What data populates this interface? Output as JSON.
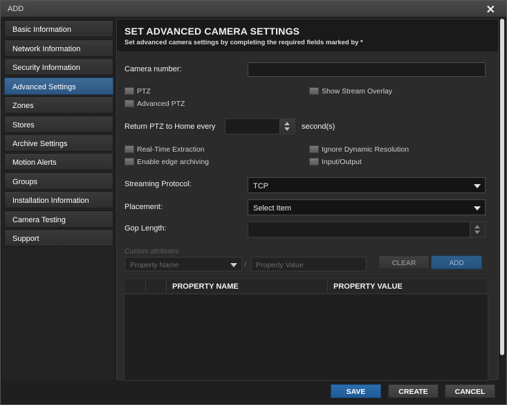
{
  "window": {
    "title": "ADD",
    "close_glyph": "✕"
  },
  "sidebar": {
    "items": [
      {
        "label": "Basic Information"
      },
      {
        "label": "Network Information"
      },
      {
        "label": "Security Information"
      },
      {
        "label": "Advanced Settings",
        "active": true
      },
      {
        "label": "Zones"
      },
      {
        "label": "Stores"
      },
      {
        "label": "Archive Settings"
      },
      {
        "label": "Motion Alerts"
      },
      {
        "label": "Groups"
      },
      {
        "label": "Installation Information"
      },
      {
        "label": "Camera Testing"
      },
      {
        "label": "Support"
      }
    ]
  },
  "header": {
    "title": "SET ADVANCED CAMERA SETTINGS",
    "subtitle": "Set advanced camera settings by completing the required fields marked by *"
  },
  "form": {
    "camera_number_label": "Camera number:",
    "camera_number_value": "",
    "ptz_label": "PTZ",
    "show_stream_overlay_label": "Show Stream Overlay",
    "advanced_ptz_label": "Advanced PTZ",
    "return_ptz_label": "Return PTZ to Home every",
    "return_ptz_value": "",
    "seconds_label": "second(s)",
    "realtime_extraction_label": "Real-Time Extraction",
    "ignore_dynamic_resolution_label": "Ignore Dynamic Resolution",
    "enable_edge_archiving_label": "Enable edge archiving",
    "input_output_label": "Input/Output",
    "streaming_protocol_label": "Streaming Protocol:",
    "streaming_protocol_value": "TCP",
    "placement_label": "Placement:",
    "placement_value": "Select Item",
    "gop_length_label": "Gop Length:",
    "gop_length_value": ""
  },
  "custom_attributes": {
    "label": "Custom attributes",
    "property_name_placeholder": "Property Name",
    "separator": "/",
    "property_value_placeholder": "Property Value",
    "clear_label": "CLEAR",
    "add_label": "ADD"
  },
  "table": {
    "columns": [
      "PROPERTY NAME",
      "PROPERTY VALUE"
    ]
  },
  "footer": {
    "save_label": "SAVE",
    "create_label": "CREATE",
    "cancel_label": "CANCEL"
  },
  "colors": {
    "accent_blue": "#2c6fb0",
    "active_nav": "#34628e",
    "background": "#2b2b2b"
  }
}
